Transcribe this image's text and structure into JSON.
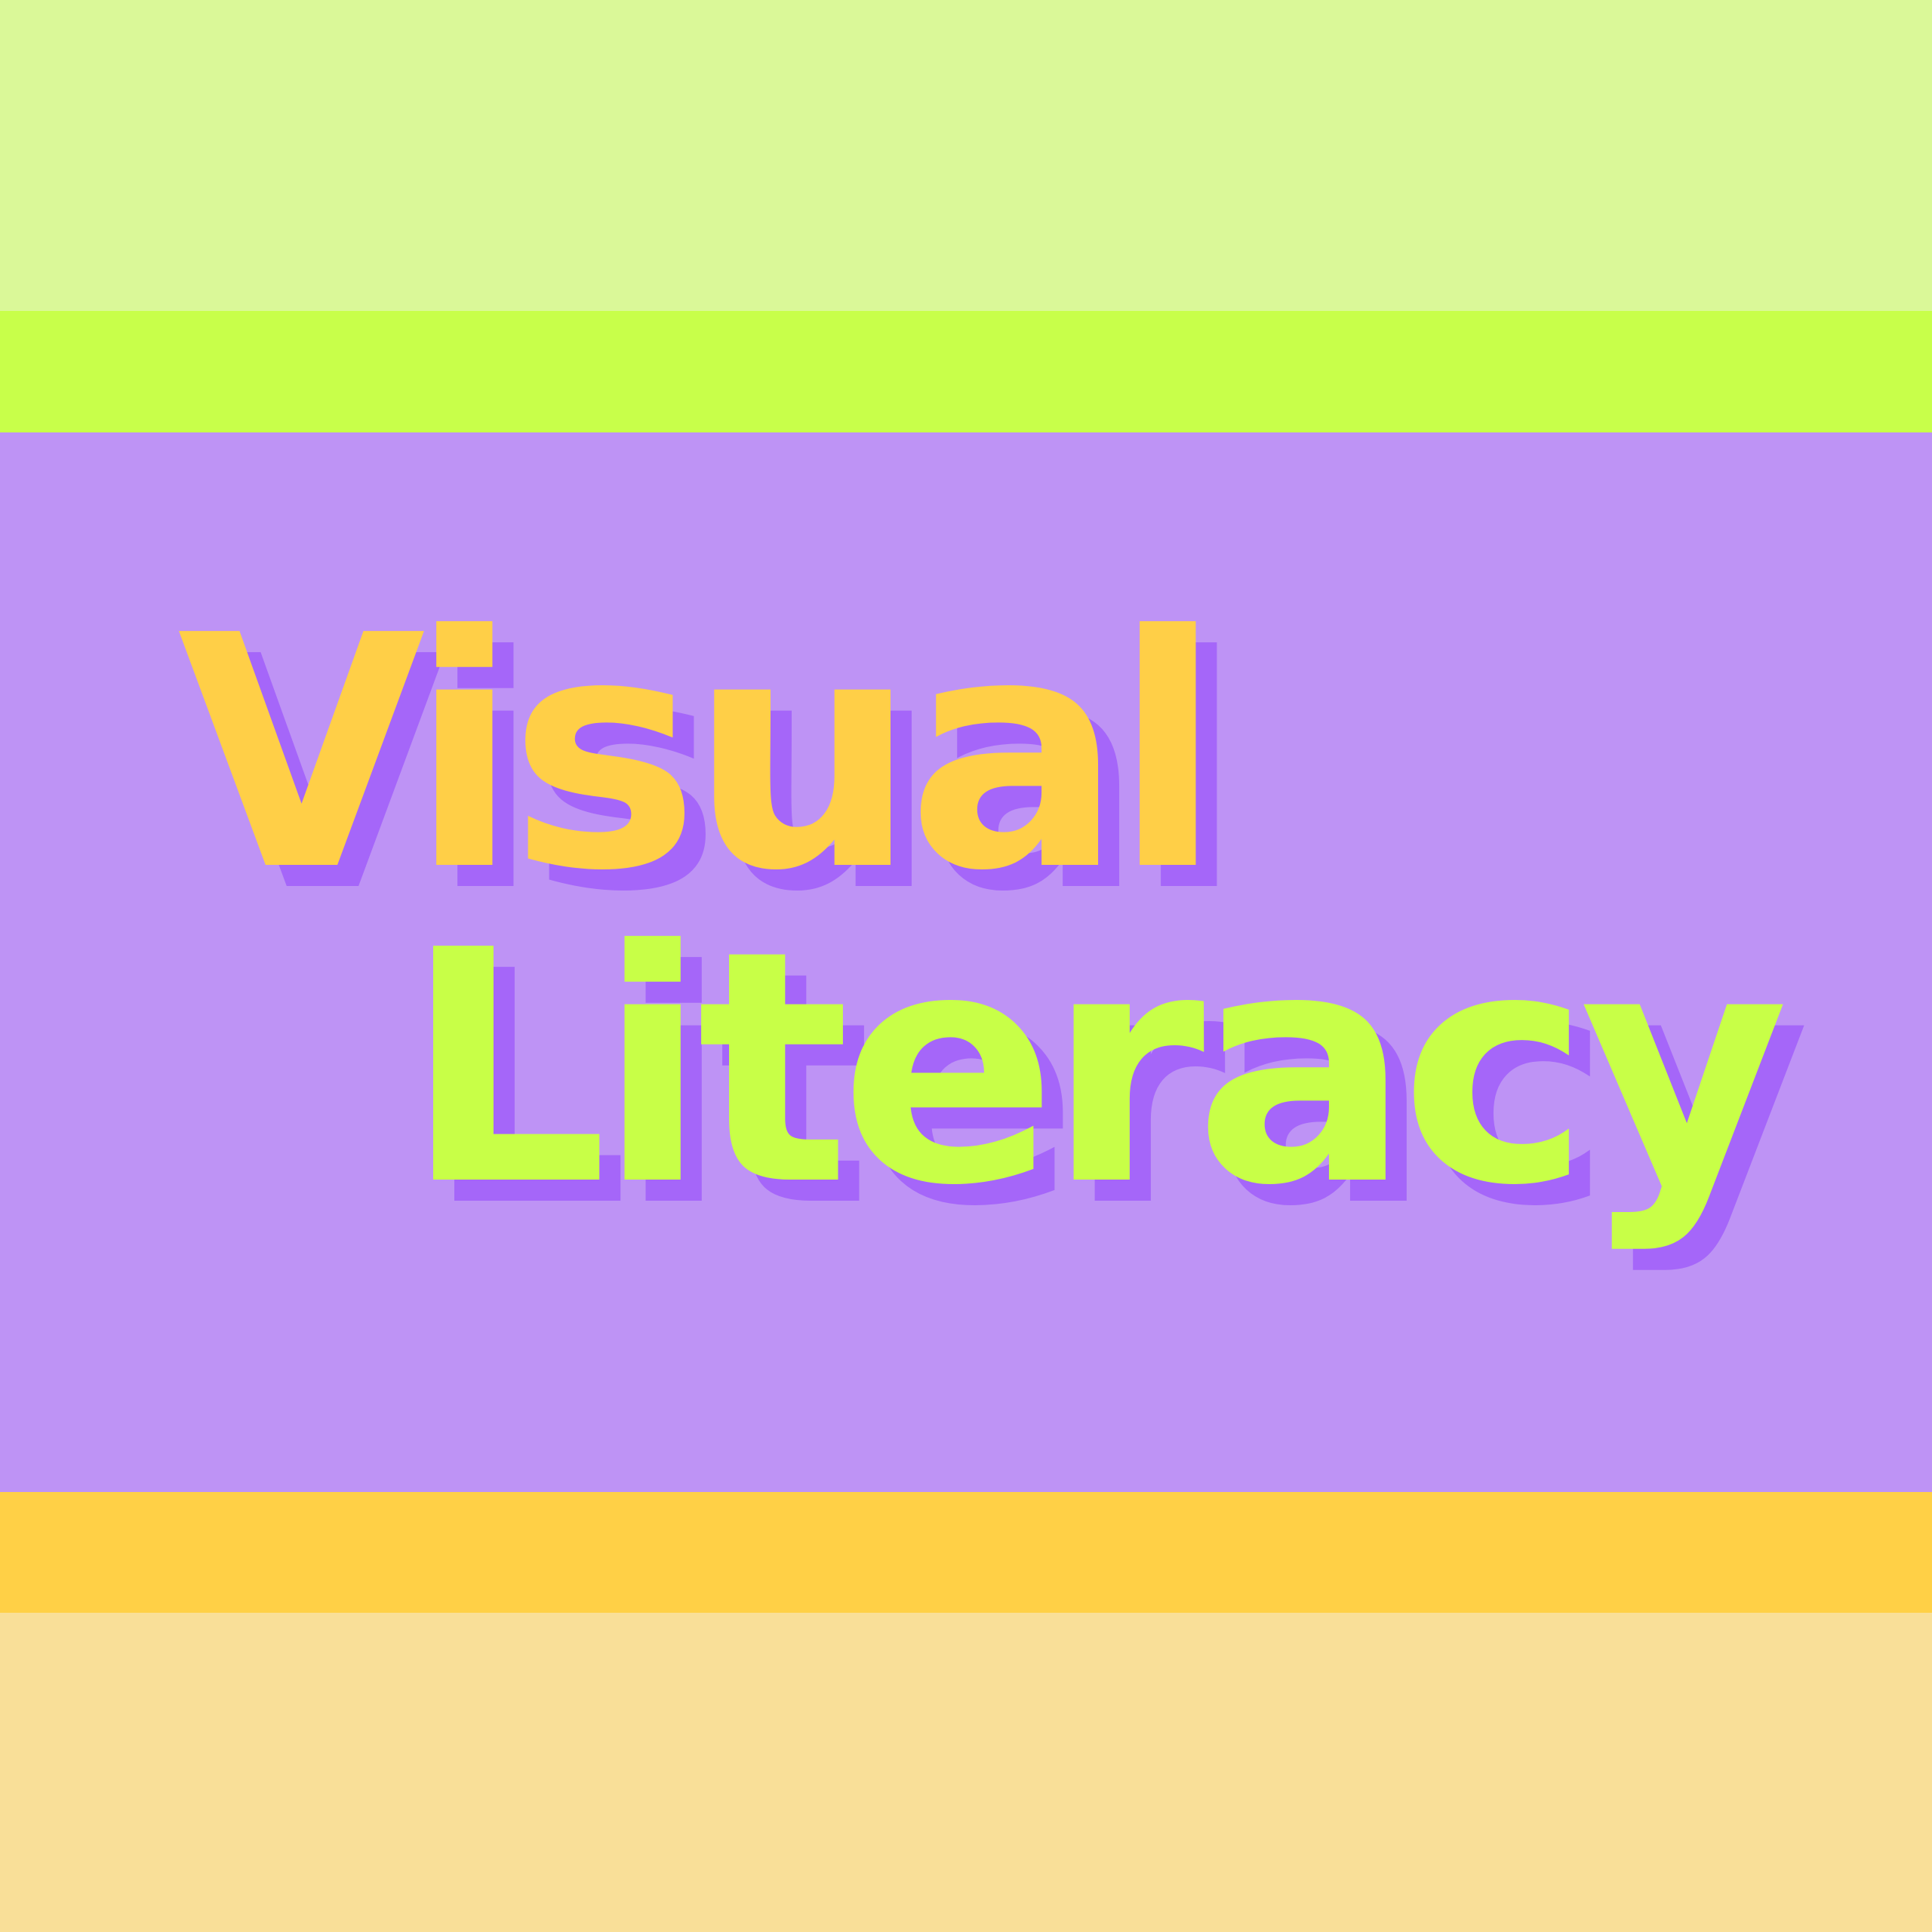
{
  "colors": {
    "top_light": "#DAF898",
    "top_lime": "#C8FF4A",
    "purple": "#BE93F5",
    "bottom_gold": "#FFD046",
    "bottom_light": "#F9DF98",
    "shadow": "#A566F9",
    "word1_fill": "#FFCF47",
    "word2_fill": "#C8FF47"
  },
  "title": {
    "line1": "Visual",
    "line2": "Literacy"
  }
}
